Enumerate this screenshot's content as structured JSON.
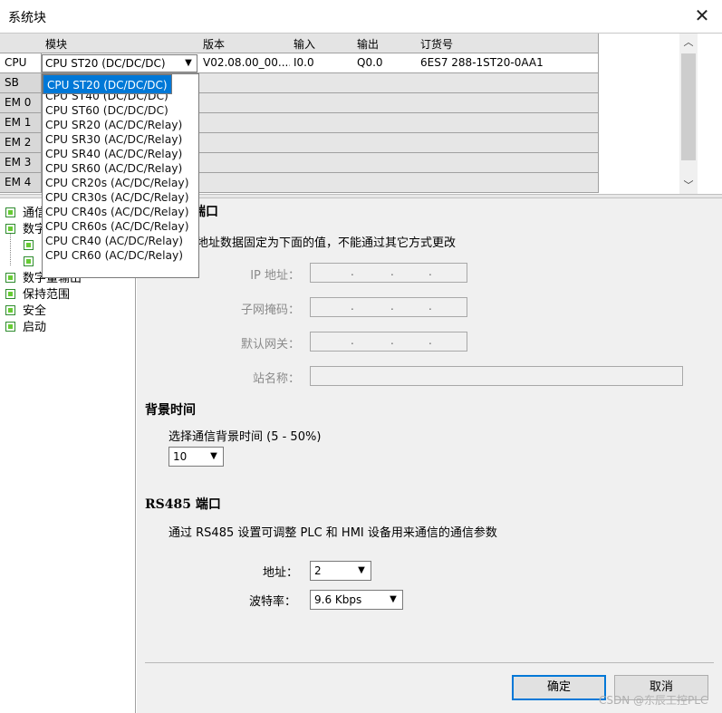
{
  "window": {
    "title": "系统块",
    "close_glyph": "✕"
  },
  "table": {
    "headers": [
      "模块",
      "版本",
      "输入",
      "输出",
      "订货号"
    ],
    "rows": [
      {
        "label": "CPU",
        "module": "CPU ST20 (DC/DC/DC)",
        "version": "V02.08.00_00....",
        "input": "I0.0",
        "output": "Q0.0",
        "order": "6ES7 288-1ST20-0AA1"
      },
      {
        "label": "SB"
      },
      {
        "label": "EM 0"
      },
      {
        "label": "EM 1"
      },
      {
        "label": "EM 2"
      },
      {
        "label": "EM 3"
      },
      {
        "label": "EM 4"
      }
    ]
  },
  "dropdown": {
    "selected_index": 0,
    "options": [
      "CPU ST20 (DC/DC/DC)",
      "CPU ST30 (DC/DC/DC)",
      "CPU ST40 (DC/DC/DC)",
      "CPU ST60 (DC/DC/DC)",
      "CPU SR20 (AC/DC/Relay)",
      "CPU SR30 (AC/DC/Relay)",
      "CPU SR40 (AC/DC/Relay)",
      "CPU SR60 (AC/DC/Relay)",
      "CPU CR20s (AC/DC/Relay)",
      "CPU CR30s (AC/DC/Relay)",
      "CPU CR40s (AC/DC/Relay)",
      "CPU CR60s (AC/DC/Relay)",
      "CPU CR40 (AC/DC/Relay)",
      "CPU CR60 (AC/DC/Relay)"
    ]
  },
  "tree": {
    "items": [
      "通信",
      "数字",
      "",
      "",
      "数字量输出",
      "保持范围",
      "安全",
      "启动"
    ]
  },
  "panel": {
    "ethernet_title_fragment": "端口",
    "ethernet_desc_fragment": "地址数据固定为下面的值，不能通过其它方式更改",
    "ip_label": "IP 地址：",
    "subnet_label": "子网掩码：",
    "gateway_label": "默认网关：",
    "station_label": "站名称：",
    "dots": ".",
    "bg_title": "背景时间",
    "bg_desc": "选择通信背景时间 (5 - 50%)",
    "bg_value": "10",
    "rs485_title": "RS485 端口",
    "rs485_desc": "通过 RS485 设置可调整 PLC 和 HMI 设备用来通信的通信参数",
    "addr_label": "地址：",
    "addr_value": "2",
    "baud_label": "波特率：",
    "baud_value": "9.6 Kbps",
    "ok_label": "确定",
    "cancel_label": "取消",
    "watermark": "CSDN @东辰工控PLC"
  }
}
